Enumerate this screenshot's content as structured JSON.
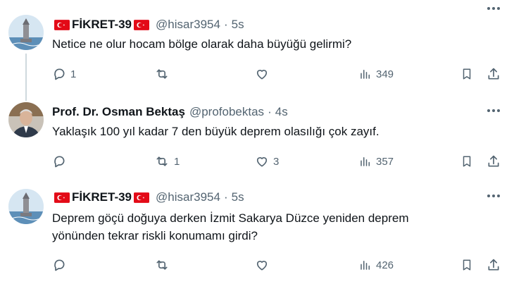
{
  "tweets": [
    {
      "name": "FİKRET-39",
      "handle": "@hisar3954",
      "dot": "·",
      "time": "5s",
      "text": "Netice ne olur hocam bölge olarak  daha büyüğü gelirmi?",
      "replies": "1",
      "retweets": "",
      "likes": "",
      "views": "349",
      "avatar_icon": "maiden-tower-icon",
      "flags": true
    },
    {
      "name": "Prof. Dr. Osman Bektaş",
      "handle": "@profobektas",
      "dot": "·",
      "time": "4s",
      "text": "Yaklaşık 100 yıl kadar 7 den büyük deprem olasılığı çok zayıf.",
      "replies": "",
      "retweets": "1",
      "likes": "3",
      "views": "357",
      "avatar_icon": "profile-photo",
      "flags": false
    },
    {
      "name": "FİKRET-39",
      "handle": "@hisar3954",
      "dot": "·",
      "time": "5s",
      "text_lines": [
        "Deprem göçü doğuya derken İzmit Sakarya Düzce yeniden deprem",
        "yönünden tekrar riskli konumamı girdi?"
      ],
      "replies": "",
      "retweets": "",
      "likes": "",
      "views": "426",
      "avatar_icon": "maiden-tower-icon",
      "flags": true
    }
  ],
  "colors": {
    "text": "#0f1419",
    "muted": "#536471",
    "flag_red": "#e30a17",
    "thread_line": "#cfd9de"
  }
}
